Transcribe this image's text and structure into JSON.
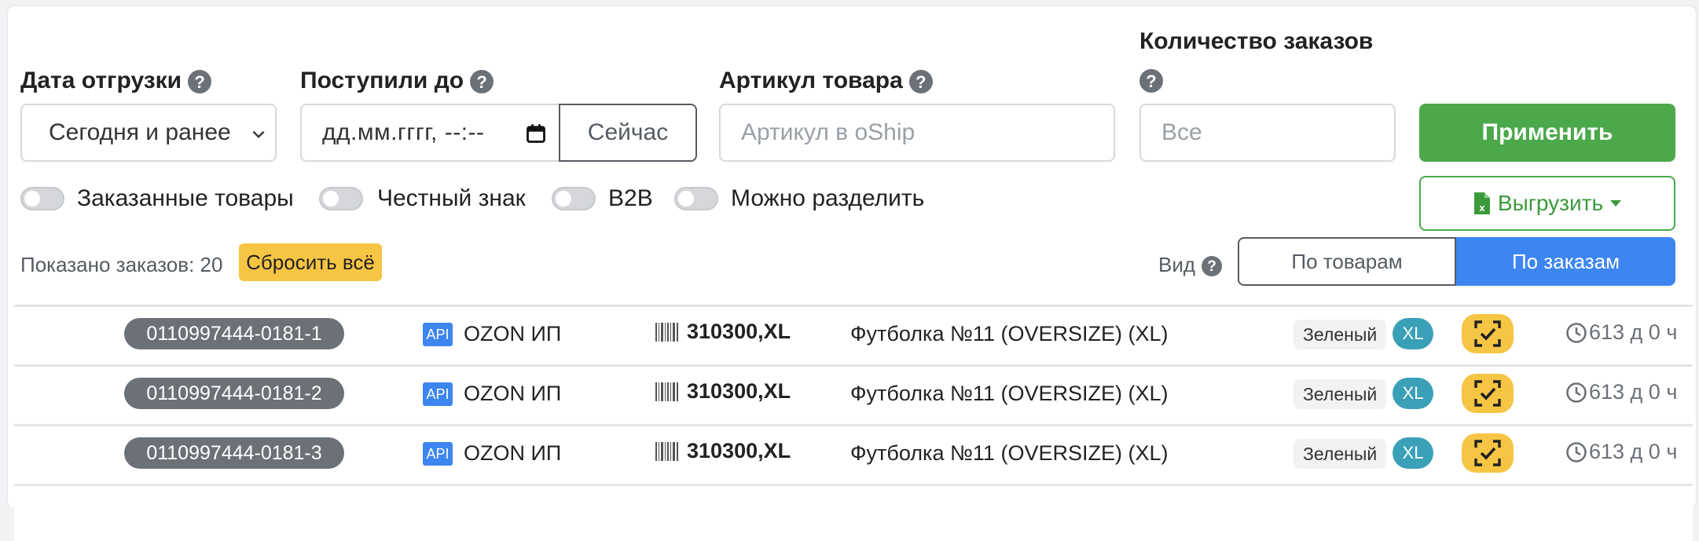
{
  "filters": {
    "ship_date": {
      "label": "Дата отгрузки",
      "value": "Сегодня и ранее"
    },
    "received_until": {
      "label": "Поступили до",
      "value": "дд.мм.гггг, --:--",
      "now_label": "Сейчас"
    },
    "sku": {
      "label": "Артикул товара",
      "placeholder": "Артикул в oShip"
    },
    "order_count": {
      "label": "Количество заказов",
      "placeholder": "Все"
    },
    "apply_label": "Применить",
    "export_label": "Выгрузить"
  },
  "toggles": [
    {
      "label": "Заказанные товары",
      "on": false
    },
    {
      "label": "Честный знак",
      "on": false
    },
    {
      "label": "B2B",
      "on": false
    },
    {
      "label": "Можно разделить",
      "on": false
    }
  ],
  "summary": {
    "shown": "Показано заказов: 20",
    "reset_label": "Сбросить всё"
  },
  "view": {
    "label": "Вид",
    "by_items": "По товарам",
    "by_orders": "По заказам",
    "active": "По заказам"
  },
  "orders": [
    {
      "id": "0110997444-0181-1",
      "api": "API",
      "shop": "OZON ИП",
      "sku": "310300,XL",
      "product": "Футболка №11 (OVERSIZE) (XL)",
      "color": "Зеленый",
      "size": "XL",
      "age": "613 д 0 ч"
    },
    {
      "id": "0110997444-0181-2",
      "api": "API",
      "shop": "OZON ИП",
      "sku": "310300,XL",
      "product": "Футболка №11 (OVERSIZE) (XL)",
      "color": "Зеленый",
      "size": "XL",
      "age": "613 д 0 ч"
    },
    {
      "id": "0110997444-0181-3",
      "api": "API",
      "shop": "OZON ИП",
      "sku": "310300,XL",
      "product": "Футболка №11 (OVERSIZE) (XL)",
      "color": "Зеленый",
      "size": "XL",
      "age": "613 д 0 ч"
    }
  ],
  "colors": {
    "green": "#4ba84b",
    "blue": "#3d86f0",
    "yellow": "#f7c544",
    "teal": "#3aa0b8",
    "gray": "#6c7178"
  }
}
